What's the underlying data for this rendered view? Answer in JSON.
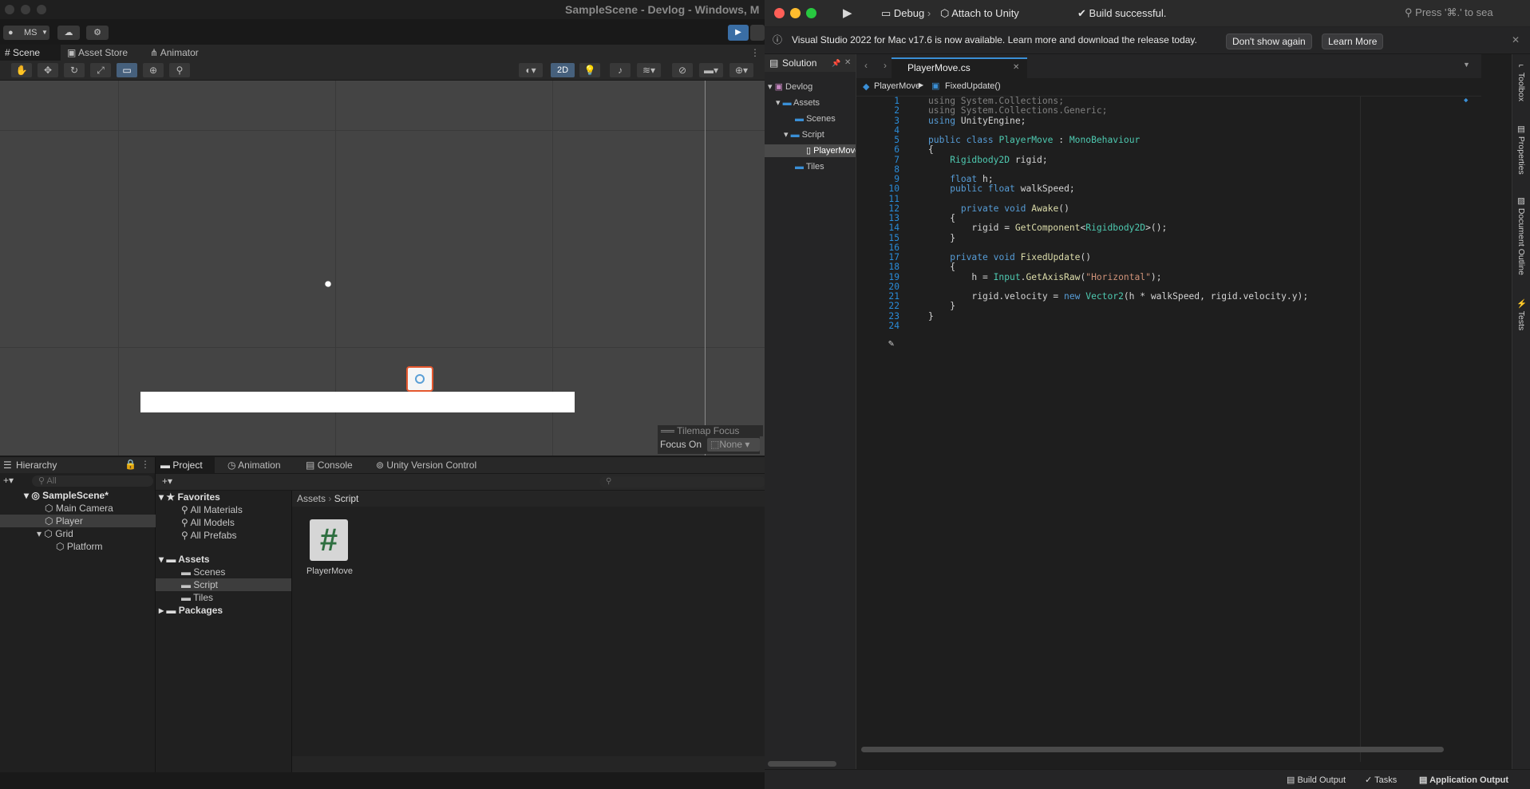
{
  "unity": {
    "window_title": "SampleScene - Devlog - Windows, M",
    "account_label": "MS",
    "tabs": [
      "Scene",
      "Asset Store",
      "Animator"
    ],
    "scene_toolbar": {
      "mode_2d": "2D"
    },
    "tilemap_focus": {
      "title": "Tilemap Focus",
      "label": "Focus On",
      "value": "None"
    },
    "bottom_tabs": [
      "Project",
      "Animation",
      "Console",
      "Unity Version Control"
    ],
    "hierarchy": {
      "title": "Hierarchy",
      "search_placeholder": "All",
      "items": [
        "SampleScene*",
        "Main Camera",
        "Player",
        "Grid",
        "Platform"
      ]
    },
    "project": {
      "favorites_label": "Favorites",
      "favorites": [
        "All Materials",
        "All Models",
        "All Prefabs"
      ],
      "assets_label": "Assets",
      "assets": [
        "Scenes",
        "Script",
        "Tiles"
      ],
      "packages_label": "Packages",
      "breadcrumb": [
        "Assets",
        "Script"
      ],
      "files": [
        {
          "name": "PlayerMove",
          "glyph": "#"
        }
      ]
    }
  },
  "vs": {
    "config": "Debug",
    "target": "Attach to Unity",
    "build_status": "Build successful.",
    "search_placeholder": "Press '⌘.' to sea",
    "info_bar": {
      "text": "Visual Studio 2022 for Mac v17.6 is now available. Learn more and download the release today.",
      "dismiss": "Don't show again",
      "learn": "Learn More"
    },
    "solution": {
      "title": "Solution",
      "items": [
        "Devlog",
        "Assets",
        "Scenes",
        "Script",
        "PlayerMove.cs",
        "Tiles"
      ]
    },
    "tab": "PlayerMove.cs",
    "breadcrumb": [
      "PlayerMove",
      "FixedUpdate()"
    ],
    "code_lines": [
      "using System.Collections;",
      "using System.Collections.Generic;",
      "using UnityEngine;",
      "",
      "public class PlayerMove : MonoBehaviour",
      "{",
      "    Rigidbody2D rigid;",
      "",
      "    float h;",
      "    public float walkSpeed;",
      "",
      "      private void Awake()",
      "    {",
      "        rigid = GetComponent<Rigidbody2D>();",
      "    }",
      "",
      "    private void FixedUpdate()",
      "    {",
      "        h = Input.GetAxisRaw(\"Horizontal\");",
      "",
      "        rigid.velocity = new Vector2(h * walkSpeed, rigid.velocity.y);",
      "    }",
      "}",
      ""
    ],
    "side_panels": [
      "Toolbox",
      "Properties",
      "Document Outline",
      "Tests"
    ],
    "status": [
      "Build Output",
      "Tasks",
      "Application Output"
    ]
  }
}
